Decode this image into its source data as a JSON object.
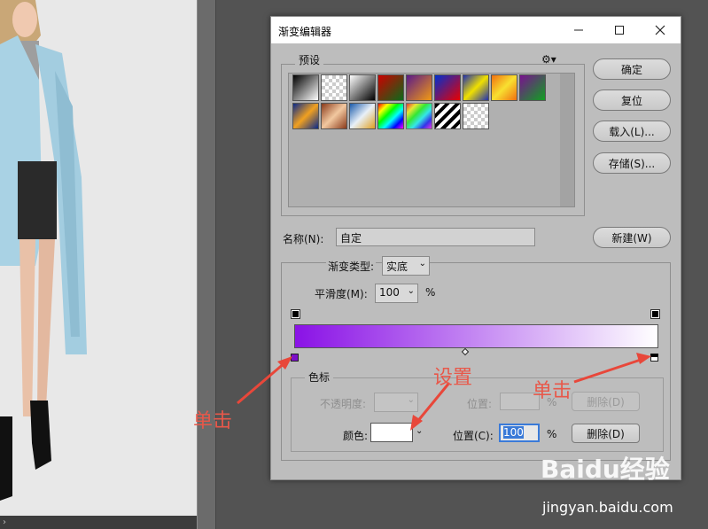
{
  "dialog": {
    "title": "渐变编辑器",
    "presets_label": "预设",
    "name_label": "名称(N):",
    "name_value": "自定",
    "gradient_type_label": "渐变类型:",
    "gradient_type_value": "实底",
    "smoothness_label": "平滑度(M):",
    "smoothness_value": "100",
    "percent": "%",
    "color_stops_label": "色标",
    "opacity_label": "不透明度:",
    "location_label_top": "位置:",
    "delete_label_top": "删除(D)",
    "color_label": "颜色:",
    "location_label": "位置(C):",
    "location_value": "100",
    "delete_label": "删除(D)"
  },
  "buttons": {
    "ok": "确定",
    "reset": "复位",
    "load": "载入(L)...",
    "save": "存储(S)...",
    "new": "新建(W)"
  },
  "annotations": {
    "click_left": "单击",
    "setting": "设置",
    "click_right": "单击"
  },
  "watermark": {
    "logo": "Baidu经验",
    "url": "jingyan.baidu.com"
  },
  "gradient": {
    "start_color": "#8a12e6",
    "end_color": "#ffffff"
  },
  "scrollbar_arrow": "›"
}
